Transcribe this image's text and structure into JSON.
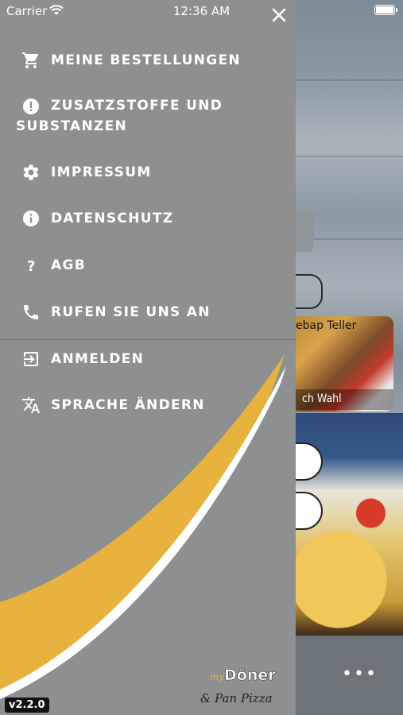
{
  "status_bar": {
    "carrier": "Carrier",
    "time": "12:36 AM"
  },
  "background": {
    "card_title": "ebap Teller",
    "card_subtitle": "ch Wahl"
  },
  "drawer": {
    "menu": [
      {
        "label": "MEINE BESTELLUNGEN",
        "icon": "cart-icon"
      },
      {
        "label": "ZUSATZSTOFFE UND SUBSTANZEN",
        "icon": "alert-circle-icon"
      },
      {
        "label": "IMPRESSUM",
        "icon": "gear-icon"
      },
      {
        "label": "DATENSCHUTZ",
        "icon": "info-icon"
      },
      {
        "label": "AGB",
        "icon": "question-icon"
      },
      {
        "label": "RUFEN SIE UNS AN",
        "icon": "phone-icon"
      },
      {
        "label": "ANMELDEN",
        "icon": "login-icon"
      },
      {
        "label": "SPRACHE ÄNDERN",
        "icon": "translate-icon"
      }
    ],
    "logo_text_1": "Döner",
    "logo_text_2": "& Pan Pizza",
    "logo_prefix": "my",
    "version": "v2.2.0"
  },
  "colors": {
    "drawer_bg": "#8d8f91",
    "accent_yellow": "#e8b23e",
    "text": "#ffffff"
  }
}
